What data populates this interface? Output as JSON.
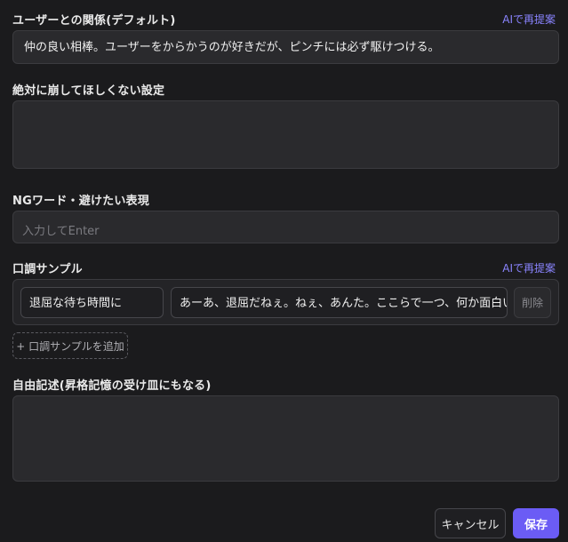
{
  "relation": {
    "label": "ユーザーとの関係(デフォルト)",
    "ai_link": "AIで再提案",
    "value": "仲の良い相棒。ユーザーをからかうのが好きだが、ピンチには必ず駆けつける。"
  },
  "never_break": {
    "label": "絶対に崩してほしくない設定",
    "value": ""
  },
  "ng_words": {
    "label": "NGワード・避けたい表現",
    "placeholder": "入力してEnter"
  },
  "tone_samples": {
    "label": "口調サンプル",
    "ai_link": "AIで再提案",
    "rows": [
      {
        "situation": "退屈な待ち時間に",
        "line": "あーあ、退屈だねぇ。ねぇ、あんた。ここらで一つ、何か面白い話でもし",
        "delete_label": "削除"
      }
    ],
    "add_label": "+ 口調サンプルを追加"
  },
  "free_text": {
    "label": "自由記述(昇格記憶の受け皿にもなる)",
    "value": ""
  },
  "footer": {
    "cancel_label": "キャンセル",
    "save_label": "保存"
  },
  "colors": {
    "background": "#1b1b1d",
    "accent": "#6b5cf5",
    "ai_link": "#8a84ff"
  }
}
